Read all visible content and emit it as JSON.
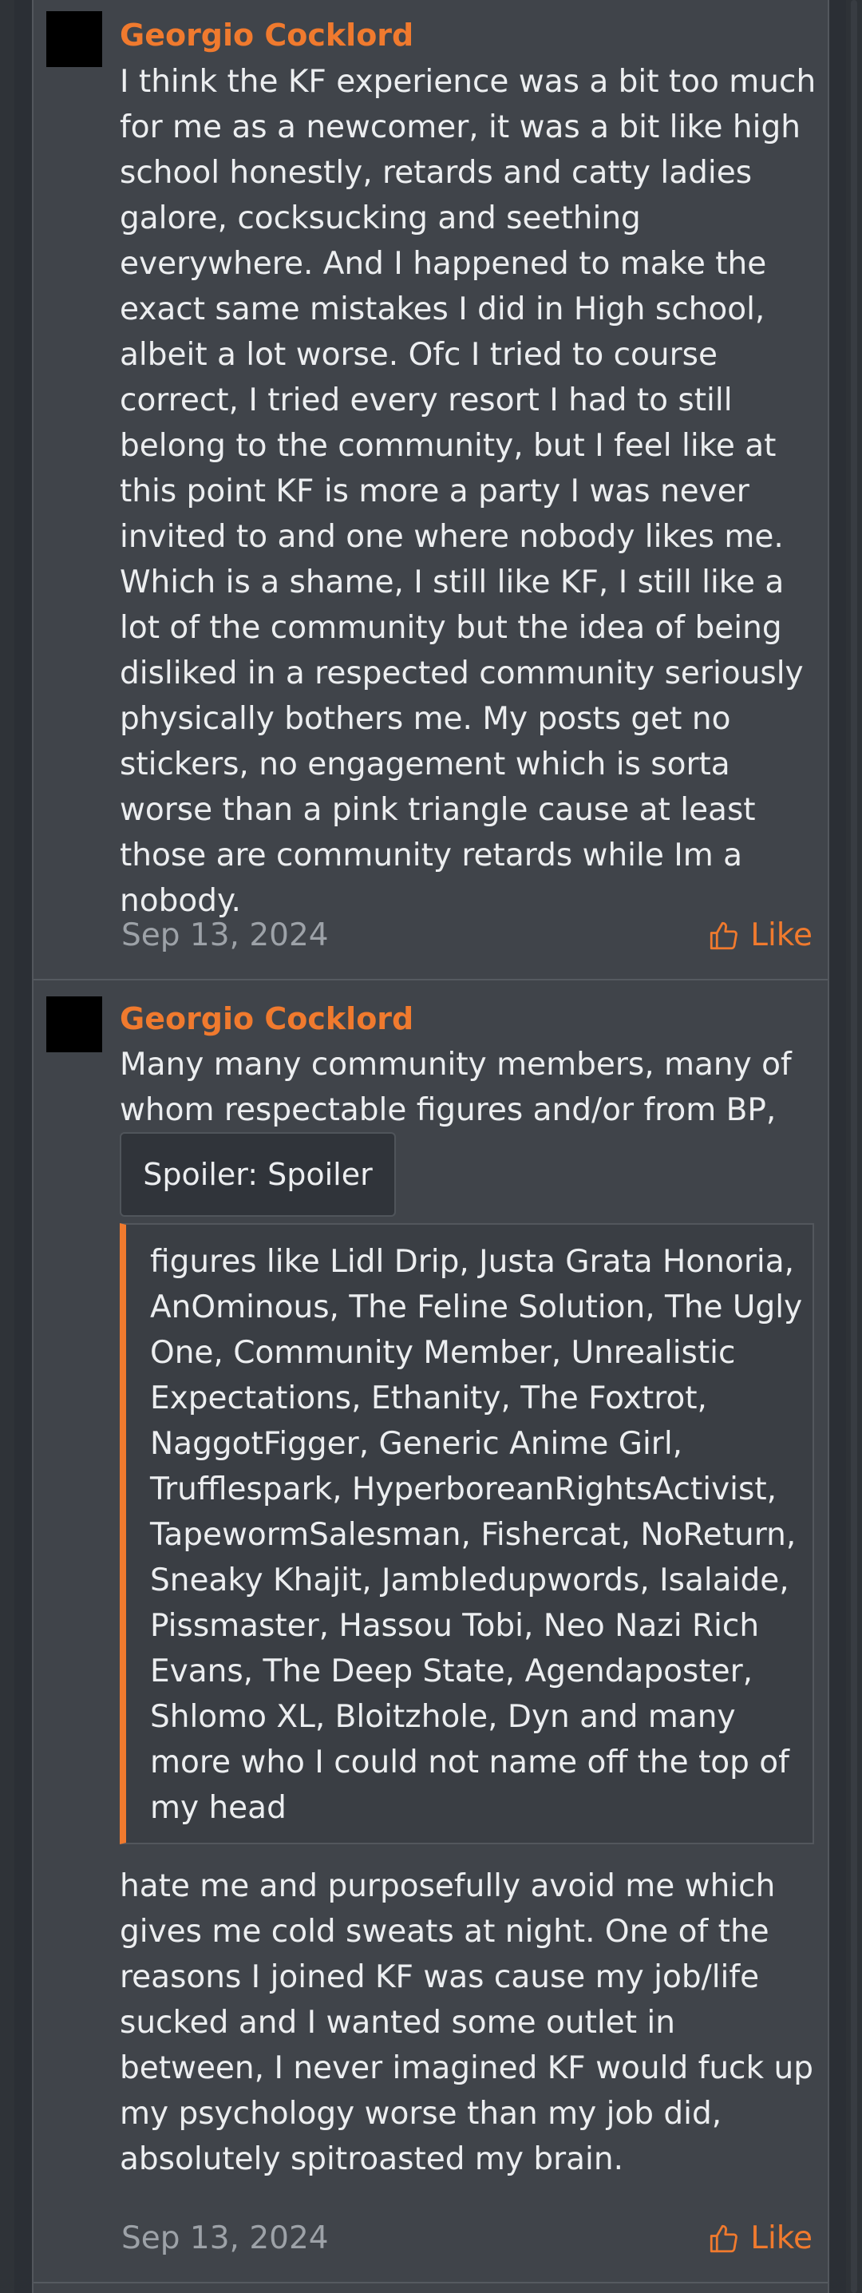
{
  "posts": [
    {
      "author": "Georgio Cocklord",
      "body": "I think the KF experience was a bit too much for me as a newcomer, it was a bit like high school honestly, retards and catty ladies galore, cocksucking and seething everywhere. And I happened to make the exact same mistakes I did in High school, albeit a lot worse. Ofc I tried to course correct, I tried every resort I had to still belong to the community, but I feel like at this point KF is more a party I was never invited to and one where nobody likes me. Which is a shame, I still like KF, I still like a lot of the community but the idea of being disliked in a respected community seriously physically bothers me. My posts get no stickers, no engagement which is sorta worse than a pink triangle cause at least those are community retards while Im a nobody.",
      "date": "Sep 13, 2024",
      "like_label": "Like"
    },
    {
      "author": "Georgio Cocklord",
      "body_intro": "Many many community members, many of whom respectable figures and/or from BP,",
      "spoiler_label": "Spoiler: Spoiler",
      "spoiler_content": "figures like Lidl Drip, Justa Grata Honoria, AnOminous, The Feline Solution, The Ugly One, Community Member, Unrealistic Expectations, Ethanity, The Foxtrot, NaggotFigger, Generic Anime Girl, Trufflespark, HyperboreanRightsActivist, TapewormSalesman, Fishercat, NoReturn, Sneaky Khajit, Jambledupwords, Isalaide, Pissmaster, Hassou Tobi, Neo Nazi Rich Evans, The Deep State, Agendaposter, Shlomo XL, Bloitzhole, Dyn and many more who I could not name off the top of my head",
      "body_outro": "hate me and purposefully avoid me which gives me cold sweats at night. One of the reasons I joined KF was cause my job/life sucked and I wanted some outlet in between, I never imagined KF would fuck up my psychology worse than my job did, absolutely spitroasted my brain.",
      "date": "Sep 13, 2024",
      "like_label": "Like"
    }
  ],
  "icons": {
    "avatar": "avatar",
    "like": "thumbs-up-icon"
  },
  "colors": {
    "accent": "#f07a2e",
    "post_bg": "#40444a",
    "page_bg": "#2b2f35"
  }
}
